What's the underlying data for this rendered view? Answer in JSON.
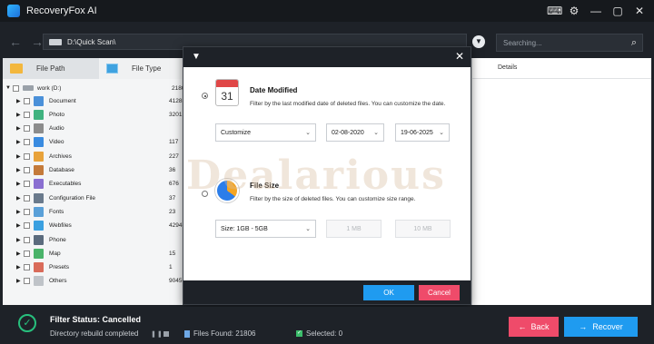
{
  "app": {
    "title": "RecoveryFox AI"
  },
  "window_controls": [
    {
      "icon": "chat-icon",
      "glyph": "⌨"
    },
    {
      "icon": "gear-icon",
      "glyph": "⚙"
    },
    {
      "icon": "minimize-icon",
      "glyph": "—"
    },
    {
      "icon": "maximize-icon",
      "glyph": "▢"
    },
    {
      "icon": "close-icon",
      "glyph": "✕"
    }
  ],
  "address": {
    "path": "D:\\Quick Scan\\",
    "search_placeholder": "Searching..."
  },
  "tabs": [
    {
      "label": "File Path"
    },
    {
      "label": "File Type"
    }
  ],
  "details_header": "Details",
  "tree": {
    "root": {
      "label": "work (D:)",
      "count": "21806"
    },
    "items": [
      {
        "label": "Document",
        "count": "4128",
        "color": "#4a90d9"
      },
      {
        "label": "Photo",
        "count": "3201",
        "color": "#3fb27f"
      },
      {
        "label": "Audio",
        "count": "",
        "color": "#8c8c8c"
      },
      {
        "label": "Video",
        "count": "117",
        "color": "#3a8be0"
      },
      {
        "label": "Archives",
        "count": "227",
        "color": "#e8a23a"
      },
      {
        "label": "Database",
        "count": "36",
        "color": "#c47a3a"
      },
      {
        "label": "Executables",
        "count": "676",
        "color": "#8a6fd1"
      },
      {
        "label": "Configuration File",
        "count": "37",
        "color": "#6a7a8c"
      },
      {
        "label": "Fonts",
        "count": "23",
        "color": "#5aa0d8"
      },
      {
        "label": "Webfiles",
        "count": "4294",
        "color": "#3aa0e0"
      },
      {
        "label": "Phone",
        "count": "",
        "color": "#5b6b7d"
      },
      {
        "label": "Map",
        "count": "15",
        "color": "#4ab36a"
      },
      {
        "label": "Presets",
        "count": "1",
        "color": "#d96b5a"
      },
      {
        "label": "Others",
        "count": "9045",
        "color": "#bfc3c8"
      }
    ]
  },
  "dialog": {
    "date": {
      "calendar_number": "31",
      "title": "Date Modified",
      "desc": "Filter by the last modified date of deleted files. You can customize the date.",
      "mode": "Customize",
      "from": "02-08-2020",
      "to": "19-06-2025"
    },
    "size": {
      "title": "File Size",
      "desc": "Filter by the size of deleted files. You can customize size range.",
      "range": "Size: 1GB - 5GB",
      "min": "1 MB",
      "max": "10 MB"
    },
    "ok_label": "OK",
    "cancel_label": "Cancel"
  },
  "watermark": "Dealarious",
  "status": {
    "title": "Filter Status: Cancelled",
    "sub": "Directory rebuild completed",
    "files_found": "Files Found: 21806",
    "selected": "Selected: 0",
    "back_label": "Back",
    "recover_label": "Recover"
  }
}
